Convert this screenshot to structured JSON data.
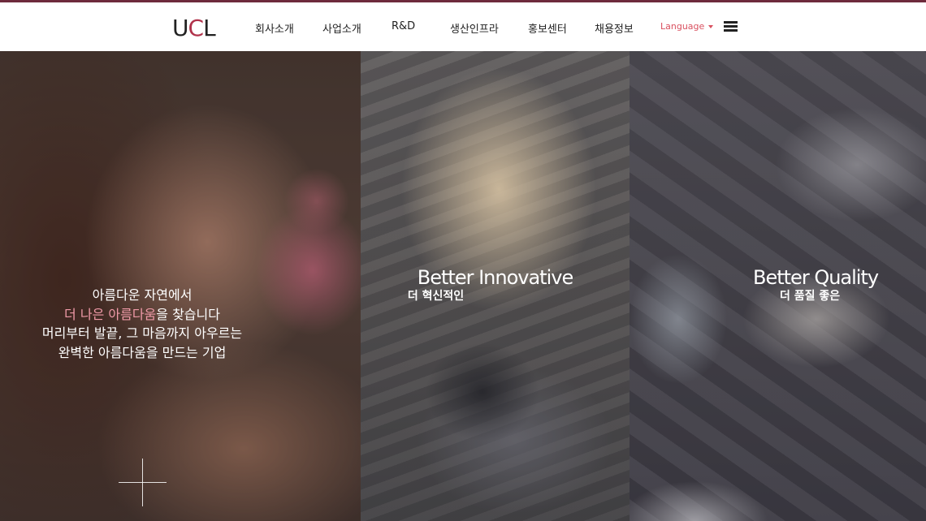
{
  "header": {
    "logo_text": "UCL",
    "nav": [
      "회사소개",
      "사업소개",
      "R&D",
      "생산인프라",
      "홍보센터",
      "채용정보"
    ],
    "language_label": "Language"
  },
  "hero": {
    "lines": [
      {
        "before": "",
        "highlight": "",
        "after": "아름다운 자연에서"
      },
      {
        "before": "",
        "highlight": "더 나은 아름다움",
        "after": "을 찾습니다"
      },
      {
        "before": "",
        "highlight": "",
        "after": "머리부터 발끝, 그 마음까지 아우르는"
      },
      {
        "before": "",
        "highlight": "",
        "after": "완벽한 아름다움을 만드는 기업"
      }
    ],
    "highlight_color": "#f09aa8"
  },
  "cards": [
    {
      "title": "Better Innovative",
      "subtitle": "더 혁신적인"
    },
    {
      "title": "Better Quality",
      "subtitle": "더 품질 좋은"
    }
  ],
  "colors": {
    "accent": "#6e2b3c",
    "language": "#d9505f"
  },
  "icons": {
    "menu": "hamburger-icon",
    "expand": "plus-icon",
    "dropdown": "caret-down-icon"
  }
}
